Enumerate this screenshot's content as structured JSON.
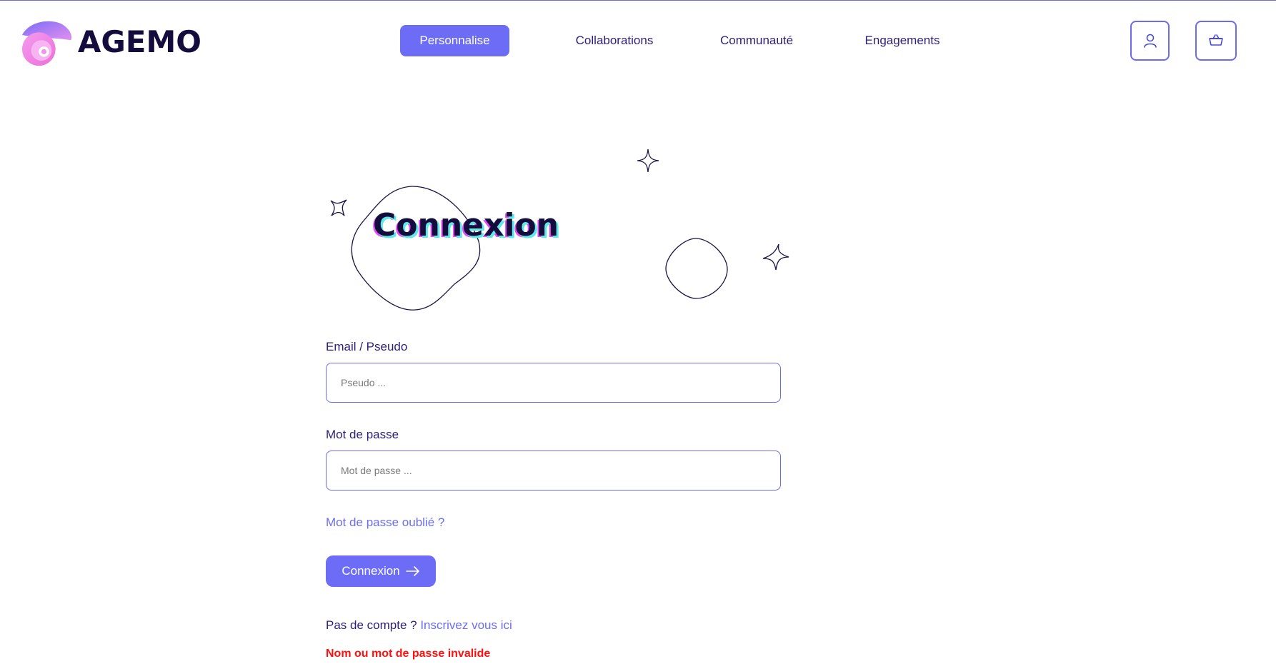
{
  "header": {
    "brand": "AGEMO",
    "nav": [
      {
        "label": "Personnalise",
        "active": true
      },
      {
        "label": "Collaborations",
        "active": false
      },
      {
        "label": "Communauté",
        "active": false
      },
      {
        "label": "Engagements",
        "active": false
      }
    ],
    "icons": [
      "user-icon",
      "basket-icon"
    ]
  },
  "page": {
    "title": "Connexion"
  },
  "form": {
    "email_label": "Email / Pseudo",
    "email_placeholder": "Pseudo ...",
    "password_label": "Mot de passe",
    "password_placeholder": "Mot de passe ...",
    "forgot_link": "Mot de passe oublié ?",
    "submit_label": "Connexion",
    "no_account_text": "Pas de compte ?",
    "register_link": "Inscrivez vous ici",
    "error_message": "Nom ou mot de passe invalide"
  },
  "colors": {
    "accent": "#6c6cf6",
    "brand_dark": "#140c3d",
    "nav_text": "#2e1f7a",
    "error": "#ff1010"
  }
}
